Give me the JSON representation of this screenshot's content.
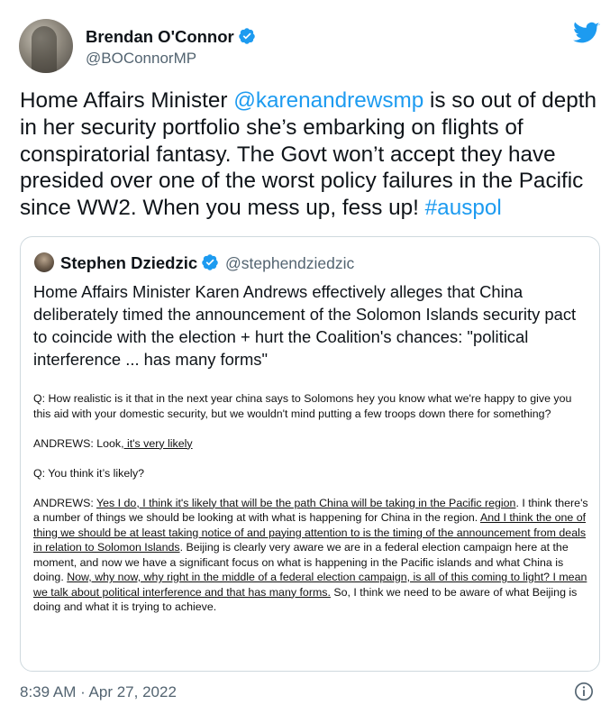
{
  "colors": {
    "link": "#1d9bf0",
    "secondary_text": "#536471",
    "border": "#cfd9de",
    "verified": "#1d9bf0"
  },
  "author": {
    "name": "Brendan O'Connor",
    "handle": "@BOConnorMP",
    "avatar_icon": "profile-photo",
    "verified_icon": "verified-badge-icon"
  },
  "brand_icon": "twitter-bird-icon",
  "tweet": {
    "line1_before": "Home Affairs Minister ",
    "mention": "@karenandrewsmp",
    "line1_after": " is so out of depth in her security portfolio she’s embarking on flights of conspiratorial fantasy. The Govt won’t accept they have presided over one of the worst policy failures in the Pacific since WW2. When you mess up, fess up! ",
    "hashtag": "#auspol"
  },
  "quoted": {
    "name": "Stephen Dziedzic",
    "handle": "@stephendziedzic",
    "text": "Home Affairs Minister Karen Andrews effectively alleges that China deliberately timed the announcement of the Solomon Islands security pact to coincide with the election + hurt the Coalition's chances: \"political interference ... has many forms\"",
    "transcript": {
      "q1": "Q: How realistic is it that in the next year china says to Solomons hey you know what we're happy to give you this aid with your domestic security, but we wouldn't mind putting a few troops down there for something?",
      "a1_prefix": "ANDREWS: Look,",
      "a1_underlined": " it's very likely",
      "q2": "Q: You think it’s likely?",
      "a2_prefix": "ANDREWS: ",
      "a2_u1": "Yes I do, I think it's likely that will be the path China will be taking in the Pacific region",
      "a2_t1": ". I think there's a number of things we should be looking at with what is happening for China in the region. ",
      "a2_u2": "And I think the one of thing we should be at least taking notice of and paying attention to is the timing of the announcement from deals in relation to Solomon Islands",
      "a2_t2": ". Beijing is clearly very aware we are in a federal election campaign here at the moment, and now we have a significant focus on what is happening in the Pacific islands and what China is doing. ",
      "a2_u3": "Now, why now, why right in the middle of a federal election campaign, is all of this coming to light? I mean we talk about political interference and that has many forms.",
      "a2_t3": " So, I think we need to be aware of what Beijing is doing and what it is trying to achieve."
    }
  },
  "timestamp": "8:39 AM · Apr 27, 2022",
  "info_icon": "info-icon"
}
